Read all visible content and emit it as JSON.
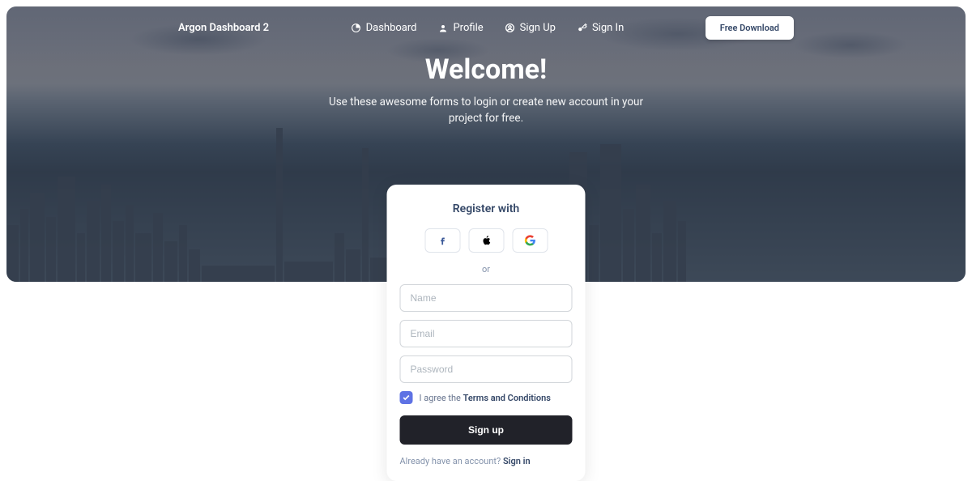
{
  "brand": "Argon Dashboard 2",
  "nav": {
    "dashboard": "Dashboard",
    "profile": "Profile",
    "signup": "Sign Up",
    "signin": "Sign In",
    "download": "Free Download"
  },
  "hero": {
    "title": "Welcome!",
    "subtitle": "Use these awesome forms to login or create new account in your project for free."
  },
  "card": {
    "title": "Register with",
    "or": "or",
    "placeholders": {
      "name": "Name",
      "email": "Email",
      "password": "Password"
    },
    "terms_prefix": "I agree the ",
    "terms_link": "Terms and Conditions",
    "terms_checked": true,
    "submit": "Sign up",
    "already_prefix": "Already have an account? ",
    "already_link": "Sign in"
  },
  "colors": {
    "primary": "#5e72e4",
    "dark": "#212229",
    "text": "#344767"
  }
}
